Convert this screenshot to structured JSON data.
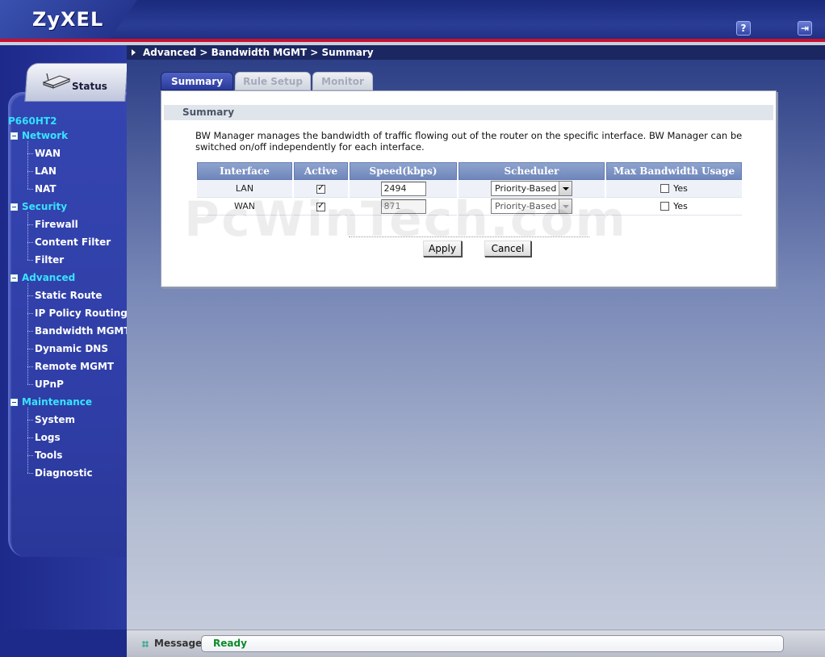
{
  "header": {
    "logo": "ZyXEL",
    "help_icon": "question-icon",
    "logout_icon": "logout-icon"
  },
  "breadcrumb": "Advanced > Bandwidth MGMT > Summary",
  "sidebar": {
    "status_label": "Status",
    "device": "P660HT2",
    "groups": [
      {
        "label": "Network",
        "items": [
          "WAN",
          "LAN",
          "NAT"
        ]
      },
      {
        "label": "Security",
        "items": [
          "Firewall",
          "Content Filter",
          "Filter"
        ]
      },
      {
        "label": "Advanced",
        "items": [
          "Static Route",
          "IP Policy Routing",
          "Bandwidth MGMT",
          "Dynamic DNS",
          "Remote MGMT",
          "UPnP"
        ]
      },
      {
        "label": "Maintenance",
        "items": [
          "System",
          "Logs",
          "Tools",
          "Diagnostic"
        ]
      }
    ]
  },
  "tabs": [
    {
      "label": "Summary",
      "active": true
    },
    {
      "label": "Rule Setup",
      "active": false
    },
    {
      "label": "Monitor",
      "active": false
    }
  ],
  "section_title": "Summary",
  "description": "BW Manager manages the bandwidth of traffic flowing out of the router on the specific interface. BW Manager can be switched on/off independently for each interface.",
  "table": {
    "headers": [
      "Interface",
      "Active",
      "Speed(kbps)",
      "Scheduler",
      "Max Bandwidth Usage"
    ],
    "rows": [
      {
        "interface": "LAN",
        "active": true,
        "speed": "2494",
        "scheduler": "Priority-Based",
        "max_bw": false,
        "max_bw_label": "Yes",
        "disabled": false
      },
      {
        "interface": "WAN",
        "active": true,
        "speed": "871",
        "scheduler": "Priority-Based",
        "max_bw": false,
        "max_bw_label": "Yes",
        "disabled": true
      }
    ]
  },
  "buttons": {
    "apply": "Apply",
    "cancel": "Cancel"
  },
  "watermark": "PcWinTech.com",
  "footer": {
    "label": "Message",
    "status": "Ready"
  },
  "colors": {
    "accent": "#2a3a9c",
    "status_ok": "#0a8a2a",
    "header_red": "#c8102e"
  }
}
